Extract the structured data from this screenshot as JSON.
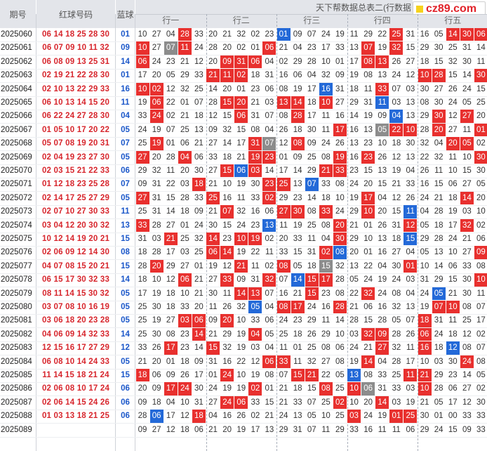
{
  "header": {
    "issue_label": "期号",
    "red_label": "红球号码",
    "blue_label": "蓝球",
    "title": "天下帮数据总表二(行数据",
    "groups": [
      "行一",
      "行二",
      "行三",
      "行四",
      "行五"
    ]
  },
  "logo": {
    "text": "cz89.com",
    "icon": "yellow-square-icon"
  },
  "colors": {
    "red_hit": "#e8302e",
    "blue_hit": "#2369d8",
    "gray_hit": "#8c8c8c",
    "red_text": "#d7262d",
    "blue_text": "#1b57c9"
  },
  "rows": [
    {
      "issue": "2025060",
      "red": "06 14 18 25 28 30",
      "blue": "01",
      "nums": [
        "10",
        "27",
        "04",
        "28",
        "33",
        "20",
        "21",
        "32",
        "02",
        "23",
        "01",
        "09",
        "07",
        "24",
        "19",
        "11",
        "29",
        "22",
        "25",
        "31",
        "16",
        "05",
        "14",
        "30",
        "06"
      ],
      "hits": {
        "3": "r",
        "10": "b",
        "18": "r",
        "22": "r",
        "23": "r",
        "24": "r"
      }
    },
    {
      "issue": "2025061",
      "red": "06 07 09 10 11 32",
      "blue": "09",
      "nums": [
        "10",
        "27",
        "07",
        "11",
        "24",
        "28",
        "20",
        "02",
        "01",
        "06",
        "21",
        "04",
        "23",
        "17",
        "33",
        "13",
        "07",
        "19",
        "32",
        "15",
        "29",
        "30",
        "25",
        "31",
        "14"
      ],
      "hits": {
        "0": "r",
        "2": "g",
        "3": "r",
        "9": "r",
        "16": "r",
        "18": "r"
      }
    },
    {
      "issue": "2025062",
      "red": "06 08 09 13 25 31",
      "blue": "14",
      "nums": [
        "06",
        "24",
        "23",
        "21",
        "12",
        "20",
        "09",
        "31",
        "06",
        "04",
        "02",
        "29",
        "28",
        "10",
        "01",
        "17",
        "08",
        "13",
        "26",
        "27",
        "18",
        "15",
        "32",
        "30",
        "11"
      ],
      "hits": {
        "0": "r",
        "6": "r",
        "7": "r",
        "8": "r",
        "16": "r",
        "17": "r"
      }
    },
    {
      "issue": "2025063",
      "red": "02 19 21 22 28 30",
      "blue": "01",
      "nums": [
        "17",
        "20",
        "05",
        "29",
        "33",
        "21",
        "11",
        "02",
        "18",
        "31",
        "16",
        "06",
        "04",
        "32",
        "09",
        "19",
        "08",
        "13",
        "24",
        "12",
        "10",
        "28",
        "15",
        "14",
        "30"
      ],
      "hits": {
        "5": "r",
        "6": "r",
        "7": "r",
        "20": "r",
        "21": "r",
        "24": "r"
      }
    },
    {
      "issue": "2025064",
      "red": "02 10 13 22 29 33",
      "blue": "16",
      "nums": [
        "10",
        "02",
        "12",
        "32",
        "25",
        "14",
        "20",
        "01",
        "23",
        "06",
        "08",
        "19",
        "17",
        "16",
        "31",
        "18",
        "11",
        "33",
        "07",
        "03",
        "30",
        "27",
        "26",
        "24",
        "15"
      ],
      "hits": {
        "0": "r",
        "1": "r",
        "13": "b",
        "17": "r"
      }
    },
    {
      "issue": "2025065",
      "red": "06 10 13 14 15 20",
      "blue": "11",
      "nums": [
        "19",
        "06",
        "22",
        "01",
        "07",
        "28",
        "15",
        "20",
        "21",
        "03",
        "13",
        "14",
        "18",
        "10",
        "27",
        "29",
        "31",
        "11",
        "03",
        "13",
        "08",
        "30",
        "24",
        "05",
        "25"
      ],
      "hits": {
        "1": "r",
        "6": "r",
        "7": "r",
        "10": "r",
        "11": "r",
        "13": "r",
        "17": "b"
      }
    },
    {
      "issue": "2025066",
      "red": "06 22 24 27 28 30",
      "blue": "04",
      "nums": [
        "33",
        "24",
        "02",
        "21",
        "18",
        "12",
        "15",
        "06",
        "31",
        "07",
        "08",
        "28",
        "17",
        "11",
        "16",
        "14",
        "19",
        "09",
        "04",
        "13",
        "29",
        "30",
        "12",
        "27",
        "20"
      ],
      "hits": {
        "1": "r",
        "7": "r",
        "11": "r",
        "18": "b",
        "21": "r",
        "23": "r"
      }
    },
    {
      "issue": "2025067",
      "red": "01 05 10 17 20 22",
      "blue": "05",
      "nums": [
        "24",
        "19",
        "07",
        "25",
        "13",
        "09",
        "32",
        "15",
        "08",
        "04",
        "26",
        "18",
        "30",
        "11",
        "17",
        "16",
        "13",
        "05",
        "22",
        "10",
        "28",
        "20",
        "27",
        "11",
        "01"
      ],
      "hits": {
        "14": "r",
        "17": "g",
        "18": "r",
        "19": "r",
        "21": "r",
        "24": "r"
      }
    },
    {
      "issue": "2025068",
      "red": "05 07 08 19 20 31",
      "blue": "07",
      "nums": [
        "25",
        "19",
        "01",
        "06",
        "21",
        "27",
        "14",
        "17",
        "31",
        "07",
        "12",
        "08",
        "09",
        "24",
        "26",
        "13",
        "23",
        "10",
        "18",
        "30",
        "32",
        "04",
        "20",
        "05",
        "02"
      ],
      "hits": {
        "1": "r",
        "8": "r",
        "9": "g",
        "11": "r",
        "22": "r",
        "23": "r"
      }
    },
    {
      "issue": "2025069",
      "red": "02 04 19 23 27 30",
      "blue": "05",
      "nums": [
        "27",
        "20",
        "28",
        "04",
        "06",
        "33",
        "18",
        "21",
        "19",
        "23",
        "01",
        "09",
        "25",
        "08",
        "19",
        "16",
        "23",
        "26",
        "12",
        "13",
        "22",
        "32",
        "11",
        "10",
        "30"
      ],
      "hits": {
        "0": "r",
        "3": "r",
        "8": "r",
        "9": "r",
        "14": "r",
        "16": "r",
        "24": "r"
      }
    },
    {
      "issue": "2025070",
      "red": "02 03 15 21 22 33",
      "blue": "06",
      "nums": [
        "29",
        "32",
        "11",
        "20",
        "30",
        "27",
        "15",
        "06",
        "03",
        "14",
        "17",
        "14",
        "29",
        "21",
        "33",
        "23",
        "15",
        "13",
        "19",
        "04",
        "26",
        "11",
        "10",
        "15",
        "30"
      ],
      "hits": {
        "6": "r",
        "7": "b",
        "8": "r",
        "13": "r",
        "14": "r"
      }
    },
    {
      "issue": "2025071",
      "red": "01 12 18 23 25 28",
      "blue": "07",
      "nums": [
        "09",
        "31",
        "22",
        "03",
        "18",
        "21",
        "10",
        "19",
        "30",
        "23",
        "25",
        "13",
        "07",
        "33",
        "08",
        "24",
        "20",
        "15",
        "21",
        "33",
        "16",
        "15",
        "06",
        "27",
        "05"
      ],
      "hits": {
        "4": "r",
        "9": "r",
        "10": "r",
        "12": "b"
      }
    },
    {
      "issue": "2025072",
      "red": "02 14 17 25 27 29",
      "blue": "05",
      "nums": [
        "27",
        "31",
        "15",
        "28",
        "33",
        "25",
        "16",
        "11",
        "33",
        "02",
        "29",
        "23",
        "14",
        "18",
        "10",
        "19",
        "17",
        "04",
        "12",
        "26",
        "24",
        "21",
        "18",
        "14",
        "20"
      ],
      "hits": {
        "0": "r",
        "5": "r",
        "9": "r",
        "16": "r",
        "23": "r"
      }
    },
    {
      "issue": "2025073",
      "red": "02 07 10 27 30 33",
      "blue": "11",
      "nums": [
        "25",
        "31",
        "14",
        "18",
        "09",
        "21",
        "07",
        "32",
        "16",
        "06",
        "27",
        "30",
        "08",
        "33",
        "24",
        "29",
        "10",
        "20",
        "15",
        "11",
        "04",
        "28",
        "19",
        "03",
        "10"
      ],
      "hits": {
        "6": "r",
        "10": "r",
        "11": "r",
        "13": "r",
        "16": "r",
        "19": "b"
      }
    },
    {
      "issue": "2025074",
      "red": "03 04 12 20 30 32",
      "blue": "13",
      "nums": [
        "33",
        "28",
        "27",
        "01",
        "24",
        "30",
        "15",
        "24",
        "23",
        "13",
        "11",
        "19",
        "25",
        "08",
        "20",
        "21",
        "01",
        "26",
        "31",
        "12",
        "05",
        "18",
        "17",
        "32",
        "02"
      ],
      "hits": {
        "0": "r",
        "9": "b",
        "14": "r",
        "19": "r",
        "23": "r"
      }
    },
    {
      "issue": "2025075",
      "red": "10 12 14 19 20 21",
      "blue": "15",
      "nums": [
        "31",
        "03",
        "21",
        "25",
        "32",
        "14",
        "23",
        "10",
        "19",
        "02",
        "20",
        "33",
        "11",
        "04",
        "30",
        "29",
        "10",
        "13",
        "18",
        "15",
        "29",
        "28",
        "24",
        "21",
        "06"
      ],
      "hits": {
        "2": "r",
        "5": "r",
        "7": "r",
        "8": "r",
        "14": "r",
        "19": "b"
      }
    },
    {
      "issue": "2025076",
      "red": "02 06 09 12 14 30",
      "blue": "08",
      "nums": [
        "18",
        "28",
        "17",
        "03",
        "25",
        "06",
        "14",
        "19",
        "22",
        "11",
        "33",
        "15",
        "31",
        "02",
        "08",
        "20",
        "01",
        "16",
        "27",
        "04",
        "05",
        "13",
        "10",
        "27",
        "09"
      ],
      "hits": {
        "5": "r",
        "6": "r",
        "13": "r",
        "14": "b",
        "24": "r"
      }
    },
    {
      "issue": "2025077",
      "red": "04 07 08 15 20 21",
      "blue": "15",
      "nums": [
        "28",
        "20",
        "29",
        "27",
        "01",
        "19",
        "12",
        "21",
        "11",
        "02",
        "08",
        "05",
        "18",
        "15",
        "32",
        "13",
        "22",
        "04",
        "30",
        "01",
        "10",
        "14",
        "06",
        "33",
        "08"
      ],
      "hits": {
        "1": "r",
        "7": "r",
        "10": "r",
        "13": "g",
        "19": "r"
      }
    },
    {
      "issue": "2025078",
      "red": "06 15 17 30 32 33",
      "blue": "14",
      "nums": [
        "18",
        "10",
        "12",
        "06",
        "21",
        "27",
        "33",
        "09",
        "31",
        "32",
        "07",
        "14",
        "15",
        "17",
        "28",
        "05",
        "24",
        "19",
        "24",
        "03",
        "31",
        "29",
        "15",
        "30",
        "10"
      ],
      "hits": {
        "3": "r",
        "6": "r",
        "9": "r",
        "11": "b",
        "12": "r",
        "13": "r",
        "24": "r"
      }
    },
    {
      "issue": "2025079",
      "red": "08 11 14 15 30 32",
      "blue": "05",
      "nums": [
        "17",
        "19",
        "18",
        "10",
        "21",
        "30",
        "11",
        "14",
        "13",
        "07",
        "16",
        "21",
        "15",
        "23",
        "08",
        "22",
        "32",
        "24",
        "08",
        "04",
        "24",
        "05",
        "21",
        "30",
        "11"
      ],
      "hits": {
        "7": "r",
        "8": "r",
        "12": "r",
        "16": "r",
        "21": "b"
      }
    },
    {
      "issue": "2025080",
      "red": "03 07 08 10 16 19",
      "blue": "05",
      "nums": [
        "25",
        "30",
        "18",
        "33",
        "20",
        "11",
        "26",
        "32",
        "05",
        "04",
        "08",
        "17",
        "24",
        "16",
        "28",
        "21",
        "06",
        "16",
        "32",
        "13",
        "19",
        "07",
        "10",
        "08",
        "07"
      ],
      "hits": {
        "8": "b",
        "10": "r",
        "11": "r",
        "14": "r",
        "21": "r",
        "22": "r"
      }
    },
    {
      "issue": "2025081",
      "red": "03 06 18 20 23 28",
      "blue": "05",
      "nums": [
        "25",
        "19",
        "27",
        "03",
        "06",
        "09",
        "20",
        "10",
        "33",
        "06",
        "24",
        "23",
        "29",
        "11",
        "14",
        "28",
        "15",
        "28",
        "05",
        "07",
        "18",
        "31",
        "11",
        "25",
        "17"
      ],
      "hits": {
        "3": "r",
        "4": "r",
        "6": "r",
        "20": "r"
      }
    },
    {
      "issue": "2025082",
      "red": "04 06 09 14 32 33",
      "blue": "14",
      "nums": [
        "25",
        "30",
        "08",
        "23",
        "14",
        "21",
        "29",
        "19",
        "04",
        "05",
        "25",
        "18",
        "26",
        "29",
        "10",
        "03",
        "32",
        "09",
        "28",
        "26",
        "06",
        "24",
        "18",
        "12",
        "02"
      ],
      "hits": {
        "4": "r",
        "8": "r",
        "16": "r",
        "17": "r",
        "20": "r"
      }
    },
    {
      "issue": "2025083",
      "red": "12 15 16 17 27 29",
      "blue": "12",
      "nums": [
        "33",
        "26",
        "17",
        "23",
        "14",
        "15",
        "32",
        "19",
        "03",
        "04",
        "11",
        "01",
        "25",
        "08",
        "06",
        "24",
        "21",
        "27",
        "32",
        "11",
        "16",
        "18",
        "12",
        "08",
        "07"
      ],
      "hits": {
        "2": "r",
        "5": "r",
        "17": "r",
        "20": "r",
        "22": "b"
      }
    },
    {
      "issue": "2025084",
      "red": "06 08 10 14 24 33",
      "blue": "05",
      "nums": [
        "21",
        "20",
        "01",
        "18",
        "09",
        "31",
        "16",
        "22",
        "12",
        "06",
        "33",
        "11",
        "32",
        "27",
        "08",
        "19",
        "14",
        "04",
        "28",
        "17",
        "10",
        "03",
        "30",
        "24",
        "08"
      ],
      "hits": {
        "9": "r",
        "10": "r",
        "16": "r",
        "23": "r"
      }
    },
    {
      "issue": "2025085",
      "red": "11 14 15 18 21 24",
      "blue": "15",
      "nums": [
        "18",
        "06",
        "09",
        "26",
        "17",
        "01",
        "24",
        "10",
        "19",
        "08",
        "07",
        "15",
        "21",
        "22",
        "05",
        "13",
        "08",
        "33",
        "25",
        "11",
        "21",
        "29",
        "23",
        "14",
        "05"
      ],
      "hits": {
        "0": "r",
        "6": "r",
        "11": "r",
        "12": "r",
        "15": "b",
        "19": "r",
        "20": "r"
      }
    },
    {
      "issue": "2025086",
      "red": "02 06 08 10 17 24",
      "blue": "06",
      "nums": [
        "20",
        "09",
        "17",
        "24",
        "30",
        "24",
        "19",
        "19",
        "02",
        "01",
        "21",
        "18",
        "15",
        "08",
        "25",
        "10",
        "06",
        "31",
        "33",
        "03",
        "10",
        "28",
        "06",
        "27",
        "02"
      ],
      "hits": {
        "2": "r",
        "3": "r",
        "8": "r",
        "13": "r",
        "15": "r",
        "16": "g",
        "20": "r"
      }
    },
    {
      "issue": "2025087",
      "red": "02 06 14 15 24 26",
      "blue": "06",
      "nums": [
        "09",
        "18",
        "04",
        "10",
        "31",
        "27",
        "24",
        "06",
        "33",
        "15",
        "21",
        "33",
        "07",
        "25",
        "02",
        "10",
        "20",
        "14",
        "03",
        "19",
        "21",
        "05",
        "17",
        "12",
        "30"
      ],
      "hits": {
        "6": "r",
        "7": "r",
        "14": "r",
        "17": "r"
      }
    },
    {
      "issue": "2025088",
      "red": "01 03 13 18 21 25",
      "blue": "06",
      "nums": [
        "28",
        "06",
        "17",
        "12",
        "18",
        "04",
        "16",
        "26",
        "02",
        "21",
        "24",
        "13",
        "05",
        "10",
        "25",
        "03",
        "24",
        "19",
        "01",
        "25",
        "30",
        "01",
        "00",
        "33",
        "33"
      ],
      "hits": {
        "1": "b",
        "4": "r",
        "15": "r",
        "18": "r",
        "19": "r"
      }
    },
    {
      "issue": "2025089",
      "red": "",
      "blue": "",
      "nums": [
        "09",
        "27",
        "12",
        "18",
        "06",
        "21",
        "20",
        "19",
        "17",
        "13",
        "29",
        "31",
        "07",
        "11",
        "29",
        "33",
        "16",
        "11",
        "11",
        "06",
        "29",
        "24",
        "15",
        "09",
        "33"
      ],
      "hits": {}
    }
  ]
}
